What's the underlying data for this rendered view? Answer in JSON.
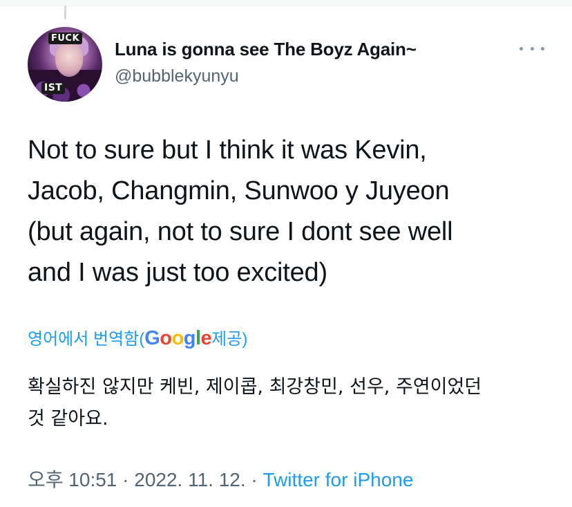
{
  "tweet": {
    "author": {
      "display_name": "Luna is gonna see The Boyz Again~",
      "handle": "@bubblekyunyu",
      "avatar_badges": [
        "FUCK",
        "IST"
      ]
    },
    "more_icon": "more-dots-icon",
    "text_lines": [
      "Not to sure but I think it was Kevin,",
      "Jacob, Changmin, Sunwoo y Juyeon",
      "(but again, not to sure I dont see well",
      "and I was just too excited)"
    ],
    "translation": {
      "label_prefix": "영어에서 번역함(",
      "google_letters": [
        {
          "char": "G",
          "color": "#4285F4"
        },
        {
          "char": "o",
          "color": "#EA4335"
        },
        {
          "char": "o",
          "color": "#FBBC05"
        },
        {
          "char": "g",
          "color": "#4285F4"
        },
        {
          "char": "l",
          "color": "#34A853"
        },
        {
          "char": "e",
          "color": "#EA4335"
        }
      ],
      "label_suffix": " 제공)",
      "text_lines": [
        "확실하진 않지만 케빈, 제이콥, 최강창민, 선우, 주연이었던",
        "것 같아요."
      ]
    },
    "meta": {
      "time_date": "오후 10:51 · 2022. 11. 12. · ",
      "source": "Twitter for iPhone"
    }
  },
  "colors": {
    "link": "#1d9bf0",
    "secondary_text": "#536471",
    "primary_text": "#0f1419"
  }
}
